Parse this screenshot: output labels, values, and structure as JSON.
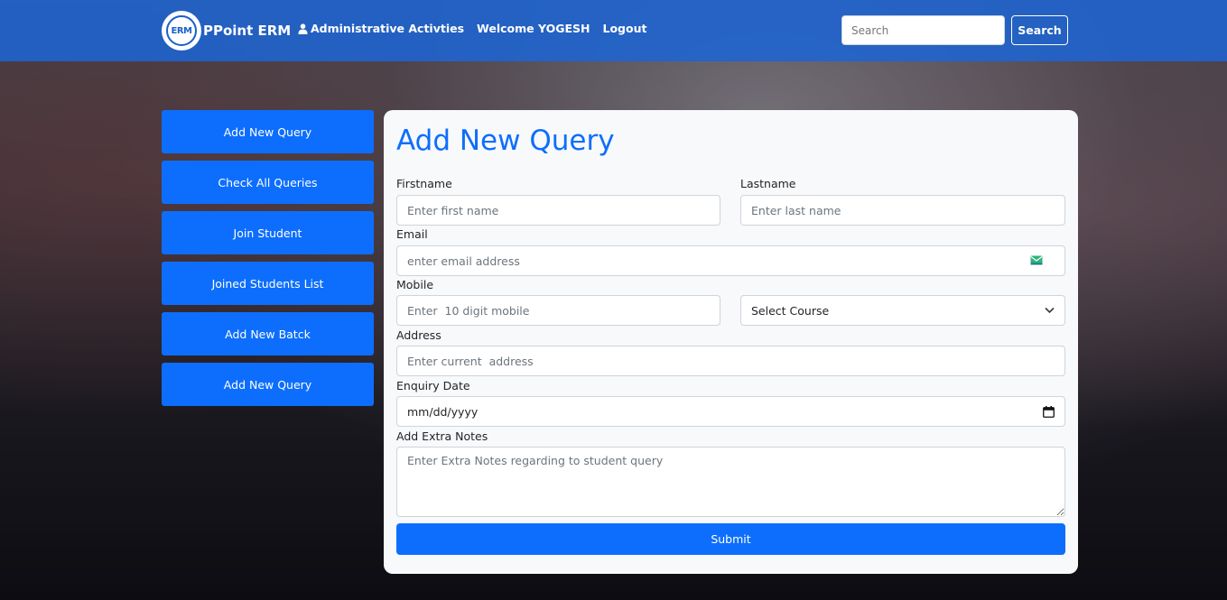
{
  "navbar": {
    "brand_logo_text": "ERM",
    "brand_name": "PPoint ERM",
    "links": {
      "admin": "Administrative Activties",
      "welcome": "Welcome YOGESH",
      "logout": "Logout"
    },
    "search": {
      "placeholder": "Search",
      "button_label": "Search"
    }
  },
  "sidebar": {
    "items": [
      {
        "label": "Add New Query"
      },
      {
        "label": "Check All Queries"
      },
      {
        "label": "Join Student"
      },
      {
        "label": "Joined Students List"
      },
      {
        "label": "Add New Batck"
      },
      {
        "label": "Add New Query"
      }
    ]
  },
  "form": {
    "title": "Add New Query",
    "firstname": {
      "label": "Firstname",
      "placeholder": "Enter first name"
    },
    "lastname": {
      "label": "Lastname",
      "placeholder": "Enter last name"
    },
    "email": {
      "label": "Email",
      "placeholder": "enter email address"
    },
    "mobile": {
      "label": "Mobile",
      "placeholder": "Enter  10 digit mobile"
    },
    "course": {
      "selected": "Select Course"
    },
    "address": {
      "label": "Address",
      "placeholder": "Enter current  address"
    },
    "enquiry_date": {
      "label": "Enquiry Date",
      "value": "mm/dd/yyyy"
    },
    "notes": {
      "label": "Add Extra Notes",
      "placeholder": "Enter Extra Notes regarding to student query"
    },
    "submit_label": "Submit"
  },
  "colors": {
    "primary": "#0d6efd",
    "navbar": "#1e64d2",
    "card_background": "#f8f9fa"
  },
  "icons": [
    "user-icon",
    "mail-icon",
    "chevron-down-icon",
    "calendar-icon"
  ]
}
